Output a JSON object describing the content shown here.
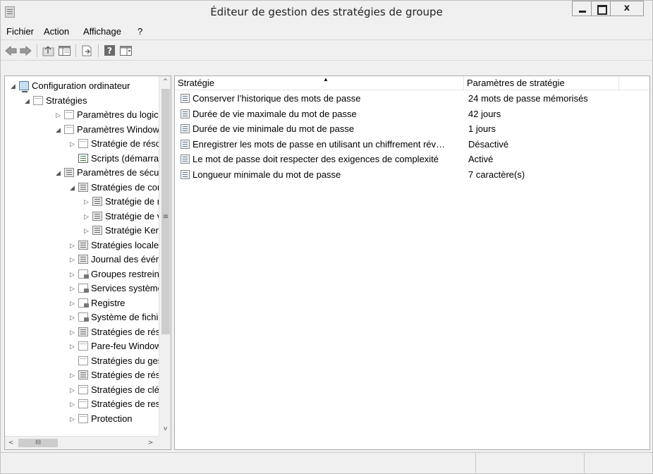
{
  "window": {
    "title": "Éditeur de gestion des stratégies de groupe",
    "close_label": "x"
  },
  "menu": [
    "Fichier",
    "Action",
    "Affichage",
    "?"
  ],
  "toolbar": {
    "buttons": [
      "back-arrow-icon",
      "forward-arrow-icon",
      "up-folder-icon",
      "show-hide-tree-icon",
      "export-list-icon",
      "help-icon",
      "properties-icon"
    ]
  },
  "tree": {
    "items": [
      {
        "label": "Configuration ordinateur",
        "icon": "computer-icon",
        "expander": "◢"
      },
      {
        "label": "Stratégies",
        "icon": "folder-icon",
        "expander": "◢"
      },
      {
        "label": "Paramètres du logiciel",
        "icon": "folder-icon",
        "expander": "▷"
      },
      {
        "label": "Paramètres Windows",
        "icon": "folder-icon",
        "expander": "◢"
      },
      {
        "label": "Stratégie de résolution de noms",
        "icon": "folder-icon",
        "expander": "▷"
      },
      {
        "label": "Scripts (démarrage/arrêt)",
        "icon": "script-icon",
        "expander": ""
      },
      {
        "label": "Paramètres de sécurité",
        "icon": "policy-icon",
        "expander": "◢"
      },
      {
        "label": "Stratégies de comptes",
        "icon": "policy-icon",
        "expander": "◢"
      },
      {
        "label": "Stratégie de mot de passe",
        "icon": "policy-icon",
        "expander": "▷"
      },
      {
        "label": "Stratégie de verrouillage du compte",
        "icon": "policy-icon",
        "expander": "▷"
      },
      {
        "label": "Stratégie Kerberos",
        "icon": "policy-icon",
        "expander": "▷"
      },
      {
        "label": "Stratégies locales",
        "icon": "policy-icon",
        "expander": "▷"
      },
      {
        "label": "Journal des événements",
        "icon": "policy-icon",
        "expander": "▷"
      },
      {
        "label": "Groupes restreints",
        "icon": "lock-folder-icon",
        "expander": "▷"
      },
      {
        "label": "Services système",
        "icon": "lock-folder-icon",
        "expander": "▷"
      },
      {
        "label": "Registre",
        "icon": "lock-folder-icon",
        "expander": "▷"
      },
      {
        "label": "Système de fichiers",
        "icon": "lock-folder-icon",
        "expander": "▷"
      },
      {
        "label": "Stratégies de réseau filaire",
        "icon": "policy-icon",
        "expander": "▷"
      },
      {
        "label": "Pare-feu Windows",
        "icon": "folder-icon",
        "expander": "▷"
      },
      {
        "label": "Stratégies du gestionnaire de listes de réseaux",
        "icon": "folder-icon",
        "expander": ""
      },
      {
        "label": "Stratégies de réseau sans fil",
        "icon": "policy-icon",
        "expander": "▷"
      },
      {
        "label": "Stratégies de clé publique",
        "icon": "folder-icon",
        "expander": "▷"
      },
      {
        "label": "Stratégies de restriction logicielle",
        "icon": "folder-icon",
        "expander": "▷"
      },
      {
        "label": "Protection",
        "icon": "folder-icon",
        "expander": "▷"
      }
    ]
  },
  "list": {
    "headers": [
      "Stratégie",
      "Paramètres de stratégie"
    ],
    "rows": [
      {
        "name": "Conserver l’historique des mots de passe",
        "value": "24 mots de passe mémorisés"
      },
      {
        "name": "Durée de vie maximale du mot de passe",
        "value": "42 jours"
      },
      {
        "name": "Durée de vie minimale du mot de passe",
        "value": "1 jours"
      },
      {
        "name": "Enregistrer les mots de passe en utilisant un chiffrement rév…",
        "value": "Désactivé"
      },
      {
        "name": "Le mot de passe doit respecter des exigences de complexité",
        "value": "Activé"
      },
      {
        "name": "Longueur minimale du mot de passe",
        "value": "7 caractère(s)"
      }
    ]
  },
  "scrollbar": {
    "grip": "≡",
    "hgrip": "III",
    "up": "^",
    "down": "v",
    "left": "<",
    "right": ">"
  }
}
